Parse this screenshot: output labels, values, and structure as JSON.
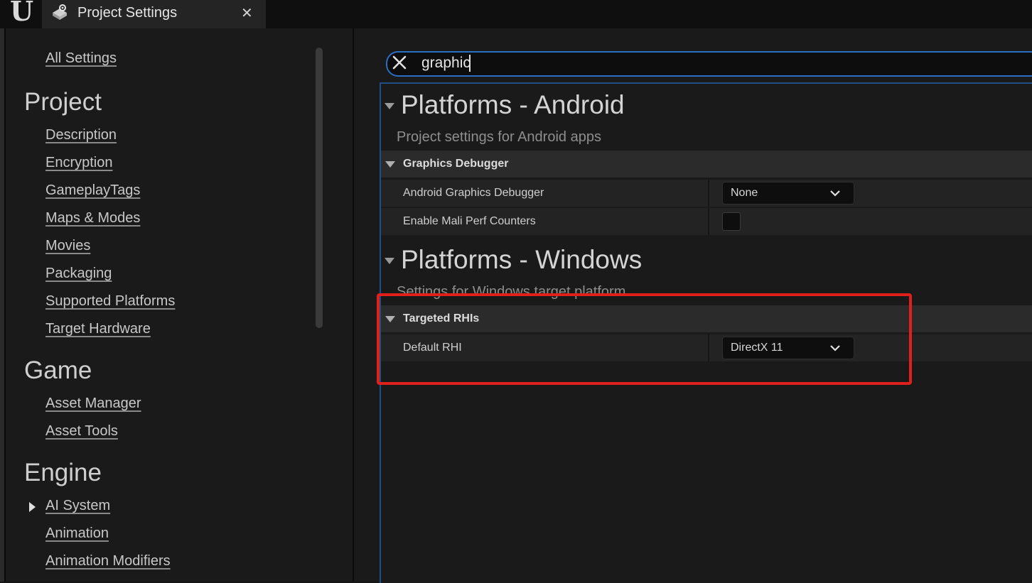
{
  "window": {
    "tab_title": "Project Settings",
    "close_glyph": "✕",
    "logo_glyph": "U"
  },
  "sidebar": {
    "all_settings": "All Settings",
    "sections": [
      {
        "heading": "Project",
        "items": [
          "Description",
          "Encryption",
          "GameplayTags",
          "Maps & Modes",
          "Movies",
          "Packaging",
          "Supported Platforms",
          "Target Hardware"
        ]
      },
      {
        "heading": "Game",
        "items": [
          "Asset Manager",
          "Asset Tools"
        ]
      },
      {
        "heading": "Engine",
        "items": [
          "AI System",
          "Animation",
          "Animation Modifiers"
        ]
      }
    ]
  },
  "search": {
    "value": "graphic"
  },
  "results": {
    "android": {
      "title": "Platforms - Android",
      "description": "Project settings for Android apps",
      "category": "Graphics Debugger",
      "props": [
        {
          "label": "Android Graphics Debugger",
          "value": "None"
        },
        {
          "label": "Enable Mali Perf Counters",
          "checked": false
        }
      ]
    },
    "windows": {
      "title": "Platforms - Windows",
      "description": "Settings for Windows target platform",
      "category": "Targeted RHIs",
      "props": [
        {
          "label": "Default RHI",
          "value": "DirectX 11"
        }
      ]
    }
  },
  "colors": {
    "highlight": "#e0201a",
    "search_border": "#2a6fc4"
  },
  "icons": {
    "tab": "settings-gear-icon",
    "search_clear": "close-icon",
    "combo": "chevron-down-icon",
    "expand": "triangle-down-icon",
    "collapsed": "triangle-right-icon"
  }
}
